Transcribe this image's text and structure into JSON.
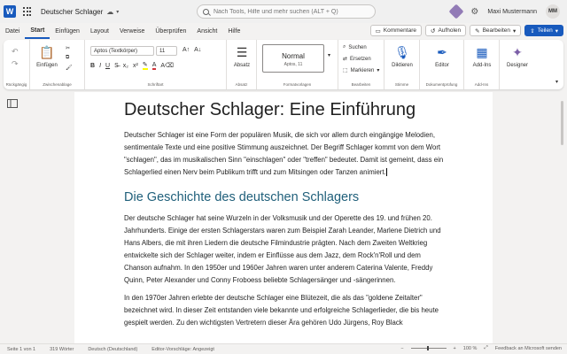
{
  "titlebar": {
    "app_letter": "W",
    "doc_title": "Deutscher Schlager",
    "search_placeholder": "Nach Tools, Hilfe und mehr suchen (ALT + Q)",
    "user_name": "Maxi Mustermann",
    "avatar_initials": "MM"
  },
  "tabs": [
    "Datei",
    "Start",
    "Einfügen",
    "Layout",
    "Verweise",
    "Überprüfen",
    "Ansicht",
    "Hilfe"
  ],
  "tab_buttons": {
    "comments": "Kommentare",
    "catchup": "Aufholen",
    "editing": "Bearbeiten",
    "share": "Teilen"
  },
  "ribbon": {
    "groups": {
      "undo": "Rückgängig",
      "clipboard": "Zwischenablage",
      "font": "Schriftart",
      "paragraph": "Absatz",
      "styles": "Formatvorlagen",
      "editing": "Bearbeiten",
      "voice": "Stimme",
      "proofing": "Dokumentprüfung",
      "addins": "Add-Ins"
    },
    "paste": "Einfügen",
    "font_name": "Aptos (Textkörper)",
    "font_size": "11",
    "paragraph_btn": "Absatz",
    "style_name": "Normal",
    "style_sub": "Aptos, 11",
    "find": "Suchen",
    "replace": "Ersetzen",
    "select": "Markieren",
    "dictate": "Diktieren",
    "editor": "Editor",
    "addins": "Add-Ins",
    "designer": "Designer"
  },
  "document": {
    "title": "Deutscher Schlager: Eine Einführung",
    "para1": "Deutscher Schlager ist eine Form der populären Musik, die sich vor allem durch eingängige Melodien, sentimentale Texte und eine positive Stimmung auszeichnet. Der Begriff Schlager kommt von dem Wort \"schlagen\", das im musikalischen Sinn \"einschlagen\" oder \"treffen\" bedeutet. Damit ist gemeint, dass ein Schlagerlied einen Nerv beim Publikum trifft und zum Mitsingen oder Tanzen animiert.",
    "heading2": "Die Geschichte des deutschen Schlagers",
    "para2": "Der deutsche Schlager hat seine Wurzeln in der Volksmusik und der Operette des 19. und frühen 20. Jahrhunderts. Einige der ersten Schlagerstars waren zum Beispiel Zarah Leander, Marlene Dietrich und Hans Albers, die mit ihren Liedern die deutsche Filmindustrie prägten. Nach dem Zweiten Weltkrieg entwickelte sich der Schlager weiter, indem er Einflüsse aus dem Jazz, dem Rock'n'Roll und dem Chanson aufnahm. In den 1950er und 1960er Jahren waren unter anderem Caterina Valente, Freddy Quinn, Peter Alexander und Conny Froboess beliebte Schlagersänger und -sängerinnen.",
    "para3": "In den 1970er Jahren erlebte der deutsche Schlager eine Blütezeit, die als das \"goldene Zeitalter\" bezeichnet wird. In dieser Zeit entstanden viele bekannte und erfolgreiche Schlagerlieder, die bis heute gespielt werden. Zu den wichtigsten Vertretern dieser Ära gehören Udo Jürgens, Roy Black"
  },
  "statusbar": {
    "page": "Seite 1 von 1",
    "words": "319 Wörter",
    "language": "Deutsch (Deutschland)",
    "editor_suggestions": "Editor-Vorschläge: Angezeigt",
    "zoom": "100 %",
    "feedback": "Feedback an Microsoft senden"
  },
  "colors": {
    "accent": "#185abd",
    "heading2": "#1f5f7a"
  }
}
